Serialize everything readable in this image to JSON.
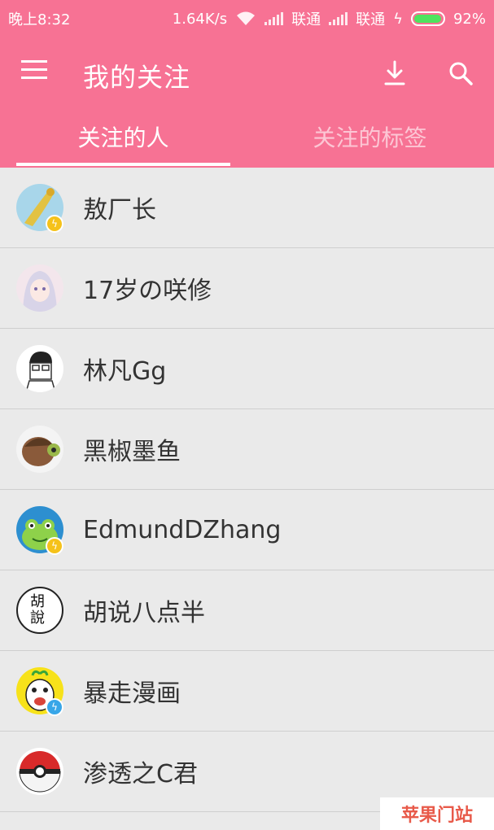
{
  "status_bar": {
    "time": "晚上8:32",
    "speed": "1.64K/s",
    "carrier1": "联通",
    "carrier2": "联通",
    "battery": "92%"
  },
  "toolbar": {
    "title": "我的关注",
    "menu_icon": "hamburger-menu-icon",
    "download_icon": "download-icon",
    "search_icon": "search-icon"
  },
  "tabs": [
    {
      "label": "关注的人",
      "active": true
    },
    {
      "label": "关注的标签",
      "active": false
    }
  ],
  "colors": {
    "brand": "#f77294",
    "badge_yellow": "#f5c21a",
    "badge_blue": "#38a6e8"
  },
  "users": [
    {
      "name": "敖厂长",
      "badge": "yellow"
    },
    {
      "name": "17岁の咲修",
      "badge": ""
    },
    {
      "name": "林凡Gg",
      "badge": ""
    },
    {
      "name": "黑椒墨鱼",
      "badge": ""
    },
    {
      "name": "EdmundDZhang",
      "badge": "yellow"
    },
    {
      "name": "胡说八点半",
      "badge": ""
    },
    {
      "name": "暴走漫画",
      "badge": "blue"
    },
    {
      "name": "渗透之C君",
      "badge": ""
    }
  ],
  "avatar_text": {
    "hushuo": "胡說"
  },
  "watermark": "苹果门站"
}
